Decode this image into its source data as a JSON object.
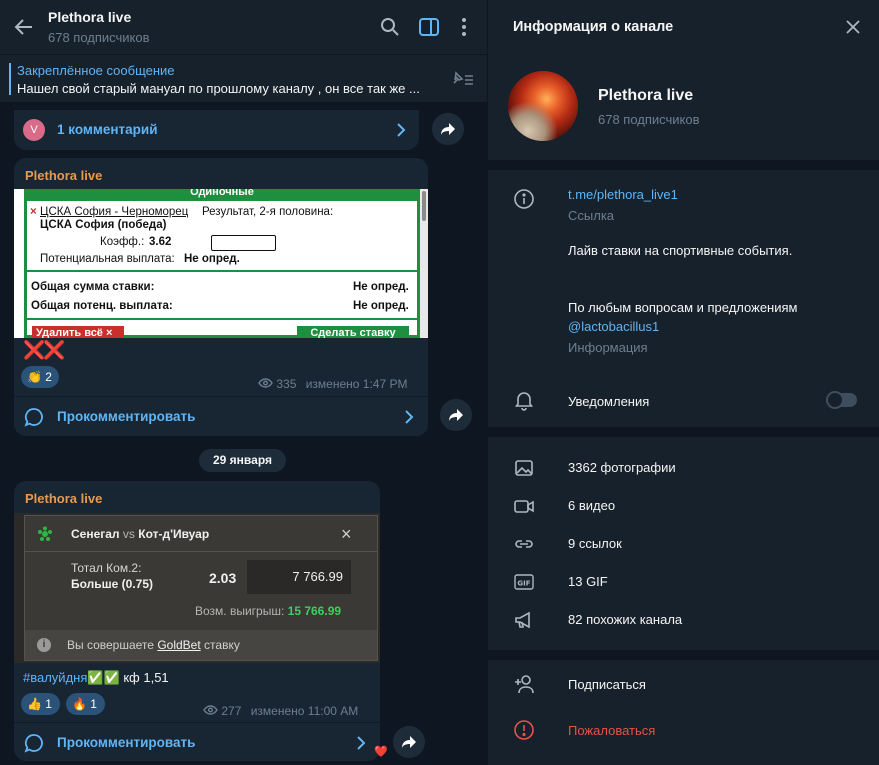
{
  "chat": {
    "title": "Plethora live",
    "subscribers": "678 подписчиков",
    "pinned": {
      "label": "Закреплённое сообщение",
      "text": "Нашел свой старый мануал по прошлому каналу , он все так же ..."
    },
    "top_comments": {
      "avatar_letter": "V",
      "label": "1 комментарий"
    },
    "post1": {
      "author": "Plethora live",
      "slip": {
        "header": "Одиночные",
        "match": "ЦСКА София - Черноморец",
        "market": "Результат, 2-я половина:",
        "pick": "ЦСКА София (победа)",
        "odds_label": "Коэфф.:",
        "odds_value": "3.62",
        "payout_label": "Потенциальная выплата:",
        "payout_value": "Не опред.",
        "total_stake_label": "Общая сумма ставки:",
        "total_stake_value": "Не опред.",
        "total_payout_label": "Общая потенц. выплата:",
        "total_payout_value": "Не опред.",
        "delete_btn": "Удалить всё ×",
        "place_btn": "Сделать ставку"
      },
      "caption": "❌❌",
      "reaction": {
        "emoji": "👏",
        "count": "2"
      },
      "views": "335",
      "edited": "изменено 1:47 PM",
      "comment_label": "Прокомментировать"
    },
    "date_chip": "29 января",
    "post2": {
      "author": "Plethora live",
      "slip": {
        "team1": "Сенегал",
        "vs": "vs",
        "team2": "Кот-д'Ивуар",
        "market_line1": "Тотал Ком.2:",
        "market_line2": "Больше (0.75)",
        "odds": "2.03",
        "stake": "7 766.99",
        "win_label": "Возм. выигрыш:",
        "win_value": "15 766.99",
        "info_prefix": "Вы совершаете",
        "info_brand": "GoldBet",
        "info_suffix": "ставку"
      },
      "caption_tag": "#валуйдня",
      "caption_checks": "✅✅",
      "caption_rest": " кф 1,51",
      "reactions": [
        {
          "emoji": "👍",
          "count": "1"
        },
        {
          "emoji": "🔥",
          "count": "1"
        }
      ],
      "views": "277",
      "edited": "изменено 11:00 AM",
      "comment_label": "Прокомментировать",
      "heart": "❤️"
    }
  },
  "info_panel": {
    "title": "Информация о канале",
    "channel_name": "Plethora live",
    "subscribers": "678 подписчиков",
    "link": "t.me/plethora_live1",
    "link_caption": "Ссылка",
    "description_1": "Лайв ставки на спортивные события.",
    "description_2": "По любым вопросам и предложениям",
    "mention": "@lactobacillus1",
    "description_caption": "Информация",
    "notifications": "Уведомления",
    "notifications_on": false,
    "media": [
      {
        "icon": "photo-icon",
        "label": "3362 фотографии"
      },
      {
        "icon": "video-icon",
        "label": "6 видео"
      },
      {
        "icon": "link-icon",
        "label": "9 ссылок"
      },
      {
        "icon": "gif-icon",
        "label": "13 GIF"
      },
      {
        "icon": "megaphone-icon",
        "label": "82 похожих канала"
      }
    ],
    "subscribe": "Подписаться",
    "report": "Пожаловаться"
  },
  "colors": {
    "background": "#0e1621",
    "panel": "#17212b",
    "bubble": "#182533",
    "accent": "#5eb5f7",
    "author": "#e89a4e",
    "danger": "#e5534b"
  }
}
